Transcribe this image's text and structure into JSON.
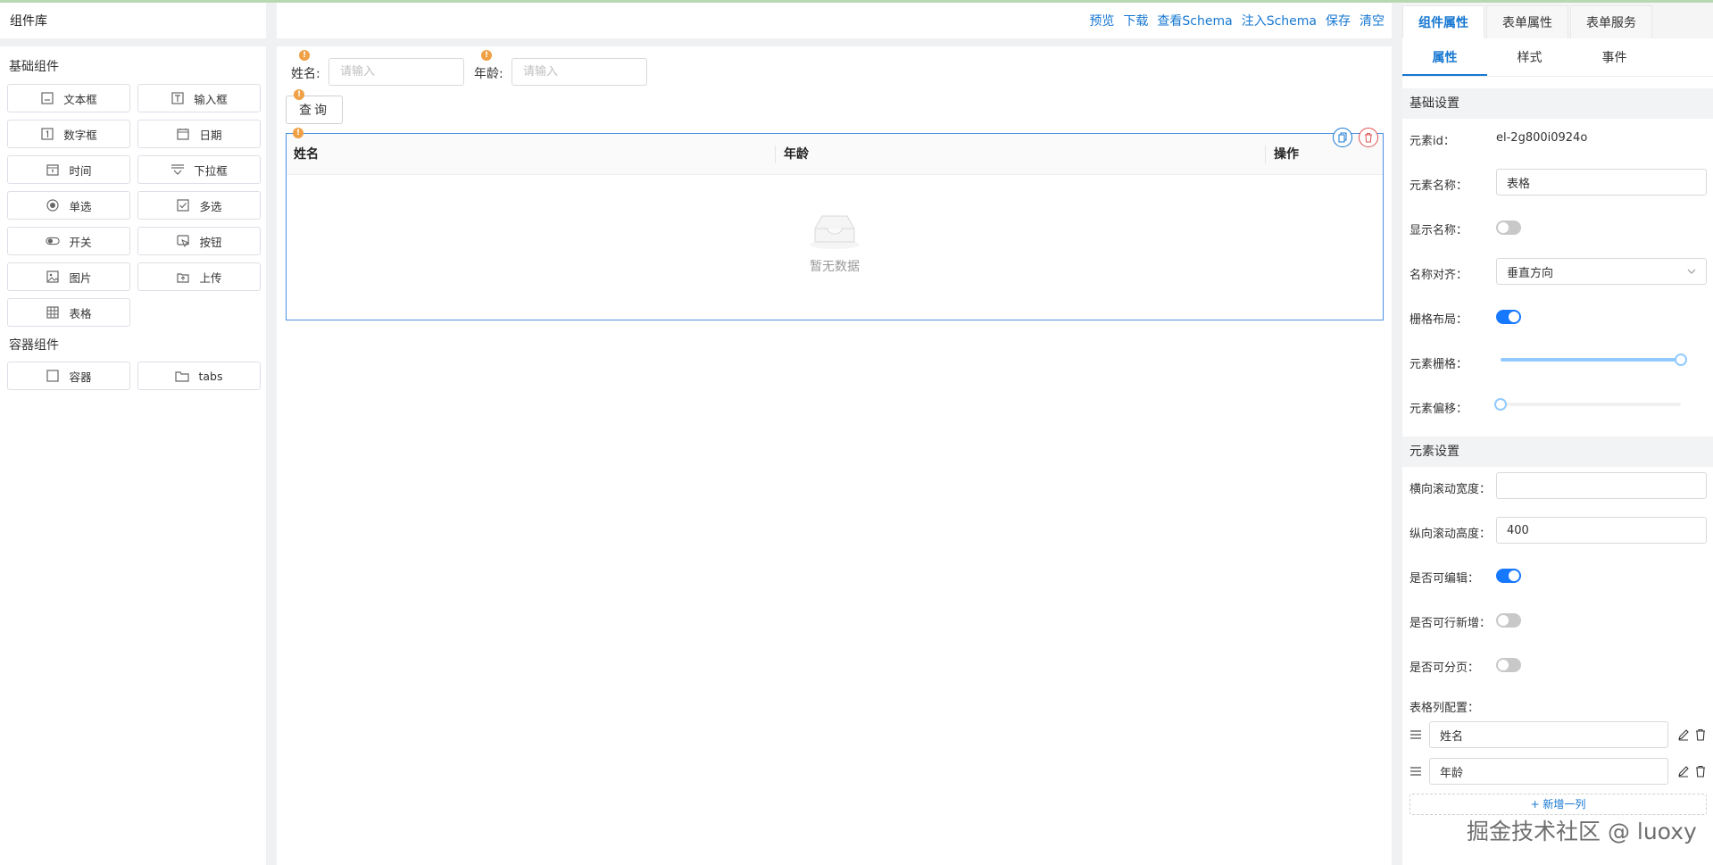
{
  "left": {
    "title": "组件库",
    "groups": [
      {
        "title": "基础组件",
        "items": [
          {
            "label": "文本框",
            "icon": "textbox-icon"
          },
          {
            "label": "输入框",
            "icon": "input-icon"
          },
          {
            "label": "数字框",
            "icon": "number-icon"
          },
          {
            "label": "日期",
            "icon": "calendar-icon"
          },
          {
            "label": "时间",
            "icon": "time-icon"
          },
          {
            "label": "下拉框",
            "icon": "dropdown-icon"
          },
          {
            "label": "单选",
            "icon": "radio-icon"
          },
          {
            "label": "多选",
            "icon": "checkbox-icon"
          },
          {
            "label": "开关",
            "icon": "switch-icon"
          },
          {
            "label": "按钮",
            "icon": "button-icon"
          },
          {
            "label": "图片",
            "icon": "image-icon"
          },
          {
            "label": "上传",
            "icon": "upload-icon"
          },
          {
            "label": "表格",
            "icon": "table-icon"
          }
        ]
      },
      {
        "title": "容器组件",
        "items": [
          {
            "label": "容器",
            "icon": "container-icon"
          },
          {
            "label": "tabs",
            "icon": "tabs-icon"
          }
        ]
      }
    ]
  },
  "toolbar": {
    "preview": "预览",
    "download": "下载",
    "view_schema": "查看Schema",
    "inject_schema": "注入Schema",
    "save": "保存",
    "clear": "清空"
  },
  "canvas": {
    "badge": "!",
    "name_label": "姓名:",
    "name_placeholder": "请输入",
    "age_label": "年龄:",
    "age_placeholder": "请输入",
    "query_button": "查询",
    "table": {
      "columns": [
        "姓名",
        "年龄",
        "操作"
      ],
      "empty_text": "暂无数据"
    }
  },
  "right": {
    "tabs": [
      "组件属性",
      "表单属性",
      "表单服务"
    ],
    "active_tab": 0,
    "subtabs": [
      "属性",
      "样式",
      "事件"
    ],
    "active_subtab": 0,
    "basic_section": "基础设置",
    "element_id_label": "元素id：",
    "element_id": "el-2g800i0924o",
    "element_name_label": "元素名称：",
    "element_name": "表格",
    "show_name_label": "显示名称：",
    "show_name": false,
    "name_align_label": "名称对齐：",
    "name_align": "垂直方向",
    "grid_layout_label": "栅格布局：",
    "grid_layout": true,
    "grid_span_label": "元素栅格：",
    "grid_span_fraction": 1.0,
    "offset_label": "元素偏移：",
    "offset_fraction": 0.0,
    "element_section": "元素设置",
    "scroll_x_label": "横向滚动宽度：",
    "scroll_x": "",
    "scroll_y_label": "纵向滚动高度：",
    "scroll_y": "400",
    "editable_label": "是否可编辑：",
    "editable": true,
    "addable_label": "是否可行新增：",
    "addable": false,
    "pageable_label": "是否可分页：",
    "pageable": false,
    "columns_label": "表格列配置：",
    "column_configs": [
      "姓名",
      "年龄"
    ],
    "add_column": "+ 新增一列"
  },
  "watermark": "掘金技术社区 @ luoxy",
  "colors": {
    "accent": "#1677d2",
    "badge": "#f0a045",
    "selection_border": "#4a90e2",
    "delete": "#e05050"
  }
}
